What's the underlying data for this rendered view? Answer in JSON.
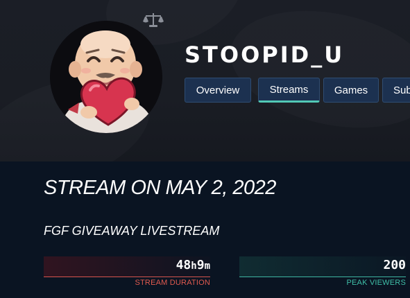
{
  "channel": {
    "name": "STOOPID_U"
  },
  "tabs": [
    {
      "label": "Overview",
      "active": false
    },
    {
      "label": "Streams",
      "active": true
    },
    {
      "label": "Games",
      "active": false
    },
    {
      "label": "Sub",
      "active": false
    }
  ],
  "stream": {
    "title": "STREAM ON MAY 2, 2022",
    "subtitle": "FGF GIVEAWAY LIVESTREAM"
  },
  "stats": {
    "duration": {
      "hours": "48",
      "hours_unit": "h",
      "minutes": "9",
      "minutes_unit": "m",
      "label": "STREAM DURATION"
    },
    "peak_viewers": {
      "value": "200",
      "label": "PEAK VIEWERS"
    }
  },
  "icons": {
    "moderator": "scale-icon"
  },
  "colors": {
    "tab_bg": "#1c3150",
    "tab_active_underline": "#52c9b6",
    "duration_accent": "#e05a4f",
    "viewers_accent": "#3fbfa8",
    "content_bg": "#0a1422"
  }
}
